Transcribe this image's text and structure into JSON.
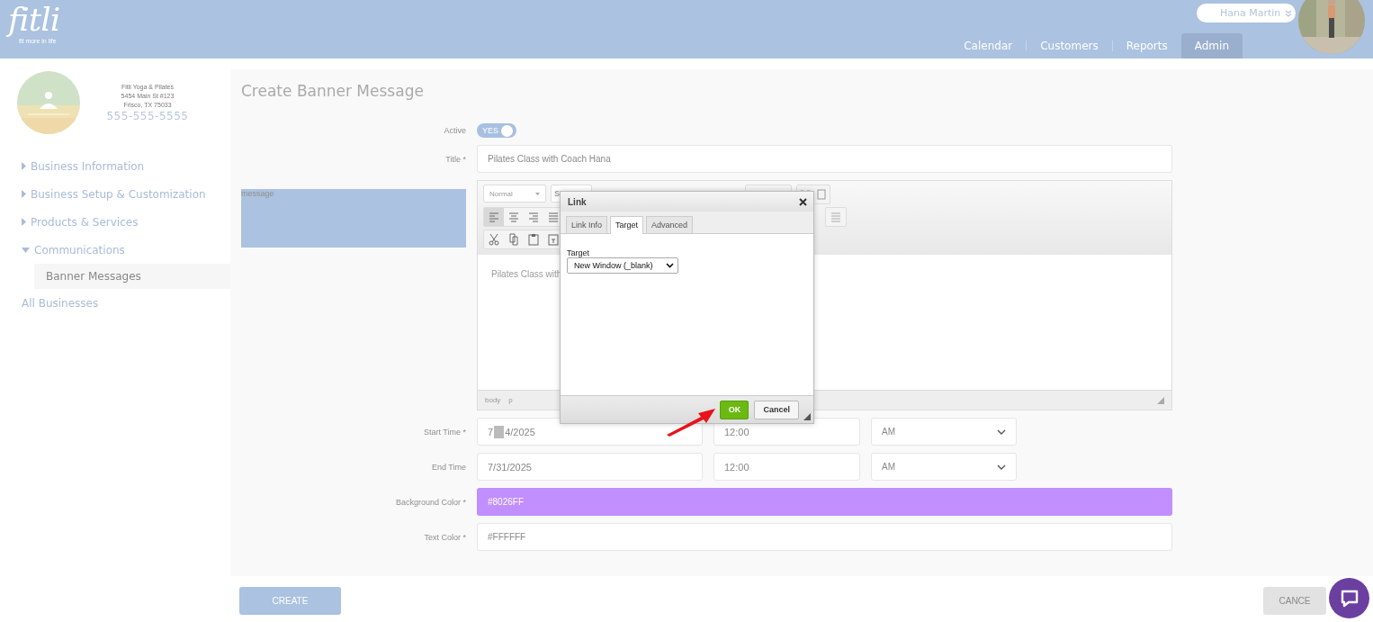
{
  "header": {
    "logo": "fitli",
    "tagline": "fit more in life",
    "user": {
      "name": "Hana Martin"
    },
    "nav": [
      {
        "label": "Calendar",
        "selected": false
      },
      {
        "label": "Customers",
        "selected": false
      },
      {
        "label": "Reports",
        "selected": false
      },
      {
        "label": "Admin",
        "selected": true
      }
    ]
  },
  "sidebar": {
    "business": {
      "name": "Fitli Yoga & Pilates",
      "address": "5454 Main St #123",
      "city": "Frisco, TX 75033",
      "phone": "555-555-5555"
    },
    "items": [
      {
        "label": "Business Information",
        "expanded": false
      },
      {
        "label": "Business Setup & Customization",
        "expanded": false
      },
      {
        "label": "Products & Services",
        "expanded": false
      },
      {
        "label": "Communications",
        "expanded": true,
        "children": [
          {
            "label": "Banner Messages",
            "selected": true
          }
        ]
      },
      {
        "label": "All Businesses"
      }
    ]
  },
  "page_title": "Create Banner Message",
  "form": {
    "active": {
      "label": "Active",
      "on": true,
      "text": "YES"
    },
    "title": {
      "label": "Title *",
      "value": "Pilates Class with Coach Hana"
    },
    "message": {
      "label": "message",
      "toolbar": {
        "format": "Normal",
        "style": "S"
      },
      "content": "Pilates Class with",
      "path": [
        "body",
        "p"
      ]
    },
    "start": {
      "label": "Start Time *",
      "date_before": "7",
      "date_after": "4/2025",
      "time": "12:00",
      "ampm": "AM"
    },
    "end": {
      "label": "End Time",
      "date": "7/31/2025",
      "time": "12:00",
      "ampm": "AM"
    },
    "background_color": {
      "label": "Background Color *",
      "value": "#8026FF",
      "color": "#c18ffe"
    },
    "text_color": {
      "label": "Text Color *",
      "value": "#FFFFFF"
    }
  },
  "dialog": {
    "title": "Link",
    "tabs": [
      {
        "label": "Link Info",
        "selected": false
      },
      {
        "label": "Target",
        "selected": true
      },
      {
        "label": "Advanced",
        "selected": false
      }
    ],
    "target_label": "Target",
    "target_value": "New Window (_blank)",
    "buttons": [
      {
        "label": "OK",
        "kind": "primary"
      },
      {
        "label": "Cancel",
        "kind": "secondary"
      }
    ]
  },
  "actions": {
    "create": "CREATE",
    "cancel": "CANCE"
  }
}
